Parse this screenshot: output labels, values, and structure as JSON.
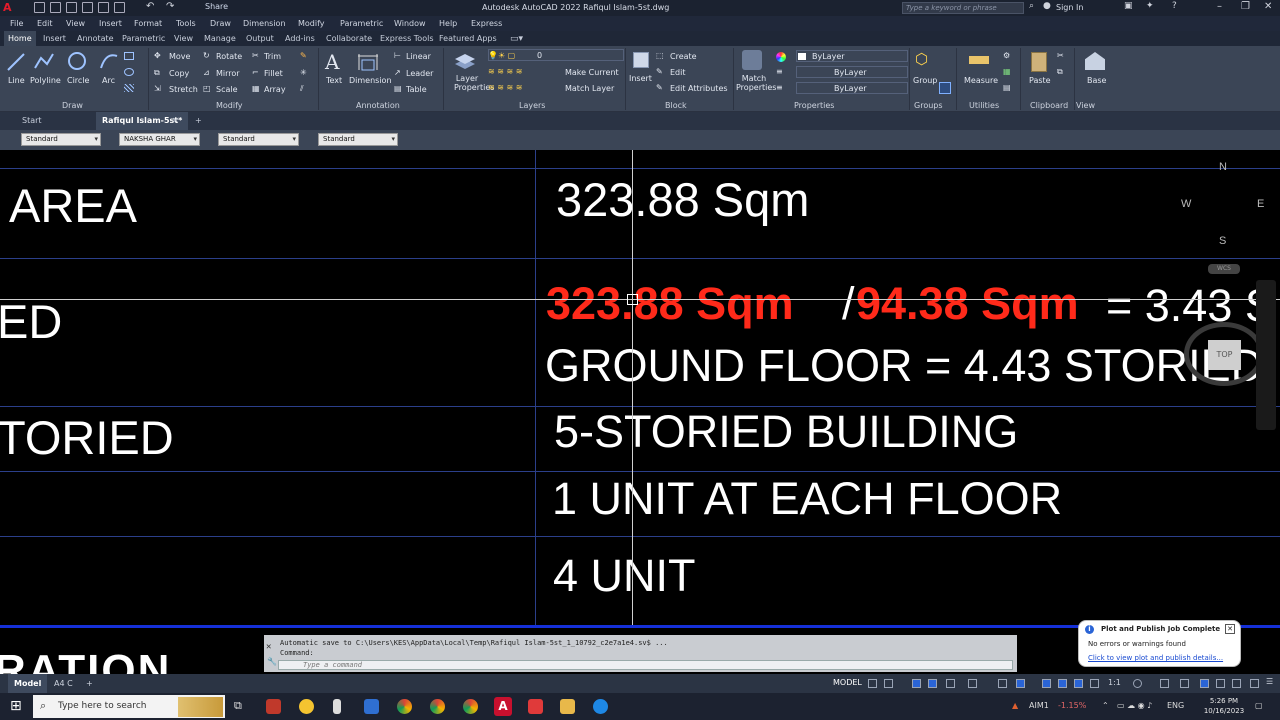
{
  "title_bar": {
    "share_label": "Share",
    "app_title": "Autodesk AutoCAD 2022   Rafiqul Islam-5st.dwg",
    "search_placeholder": "Type a keyword or phrase",
    "signin_label": "Sign In"
  },
  "menu": [
    "File",
    "Edit",
    "View",
    "Insert",
    "Format",
    "Tools",
    "Draw",
    "Dimension",
    "Modify",
    "Parametric",
    "Window",
    "Help",
    "Express"
  ],
  "ribbon_tabs": [
    "Home",
    "Insert",
    "Annotate",
    "Parametric",
    "View",
    "Manage",
    "Output",
    "Add-ins",
    "Collaborate",
    "Express Tools",
    "Featured Apps"
  ],
  "ribbon": {
    "draw": {
      "title": "Draw",
      "tools": [
        "Line",
        "Polyline",
        "Circle",
        "Arc"
      ]
    },
    "modify": {
      "title": "Modify",
      "tools": [
        "Move",
        "Rotate",
        "Trim",
        "Copy",
        "Mirror",
        "Fillet",
        "Stretch",
        "Scale",
        "Array"
      ]
    },
    "annotation": {
      "title": "Annotation",
      "tools": [
        "Text",
        "Dimension",
        "Linear",
        "Leader",
        "Table"
      ]
    },
    "layers": {
      "title": "Layers",
      "layer_properties": "Layer Properties",
      "current_layer": "0",
      "make_current": "Make Current",
      "match_layer": "Match Layer"
    },
    "block": {
      "title": "Block",
      "insert": "Insert",
      "create": "Create",
      "edit": "Edit",
      "edit_attributes": "Edit Attributes"
    },
    "properties": {
      "title": "Properties",
      "match_properties": "Match Properties",
      "bylayer_1": "ByLayer",
      "bylayer_2": "ByLayer",
      "bylayer_3": "ByLayer"
    },
    "groups": {
      "title": "Groups",
      "group": "Group"
    },
    "utilities": {
      "title": "Utilities",
      "measure": "Measure"
    },
    "clipboard": {
      "title": "Clipboard",
      "paste": "Paste"
    },
    "view": {
      "title": "View",
      "base": "Base"
    }
  },
  "file_tabs": [
    "Start",
    "Rafiqul Islam-5st*"
  ],
  "style_bar": {
    "text_style": "Standard",
    "dim_style": "NAKSHA GHAR",
    "table_style": "Standard",
    "mleader_style": "Standard"
  },
  "drawing": {
    "left_area": "AREA",
    "left_ed": "ED",
    "left_toried": "TORIED",
    "area_value": "323.88 Sqm",
    "far_numerator": "323.88 Sqm",
    "far_slash": "/",
    "far_denominator": "94.38 Sqm",
    "far_result": "= 3.43 S",
    "ground_floor": "GROUND FLOOR = 4.43 STORIED",
    "building": "5-STORIED  BUILDING",
    "unit_each_floor": "1 UNIT AT EACH FLOOR",
    "units": "4 UNIT",
    "bottom_partial": "RATION"
  },
  "viewcube": {
    "n": "N",
    "s": "S",
    "e": "E",
    "w": "W",
    "top": "TOP",
    "wcs": "WCS"
  },
  "command_line": {
    "history_1": "Automatic save to C:\\Users\\KES\\AppData\\Local\\Temp\\Rafiqul Islam-5st_1_10792_c2e7a1e4.sv$ ...",
    "history_2": "Command:",
    "placeholder": "Type a command"
  },
  "notification": {
    "title": "Plot and Publish Job Complete",
    "message": "No errors or warnings found",
    "link": "Click to view plot and publish details..."
  },
  "layout_tabs": [
    "Model",
    "A4 C"
  ],
  "status_bar": {
    "model_label": "MODEL",
    "scale": "1:1"
  },
  "taskbar": {
    "search_placeholder": "Type here to search",
    "stock_label": "AIM1",
    "stock_change": "-1.15%",
    "lang": "ENG",
    "time": "5:26 PM",
    "date": "10/16/2023"
  },
  "colors": {
    "ribbon_bg": "#3b4556",
    "drawing_red": "#ff2a1a",
    "grid_blue": "#2b3f8a",
    "band_blue": "#1530d8"
  }
}
